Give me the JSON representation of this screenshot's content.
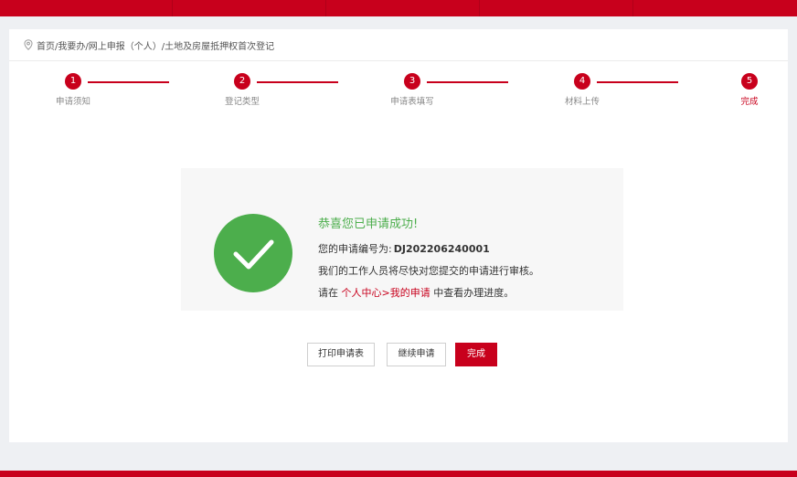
{
  "colors": {
    "accent": "#c8001c",
    "success": "#4cae4c"
  },
  "breadcrumb": {
    "icon": "location-pin-icon",
    "text": "首页/我要办/网上申报（个人）/土地及房屋抵押权首次登记"
  },
  "steps": [
    {
      "num": "1",
      "label": "申请须知"
    },
    {
      "num": "2",
      "label": "登记类型"
    },
    {
      "num": "3",
      "label": "申请表填写"
    },
    {
      "num": "4",
      "label": "材料上传"
    },
    {
      "num": "5",
      "label": "完成"
    }
  ],
  "result": {
    "icon": "check-circle-icon",
    "title": "恭喜您已申请成功!",
    "app_no_label": "您的申请编号为:",
    "app_no": "DJ202206240001",
    "review_text": "我们的工作人员将尽快对您提交的申请进行审核。",
    "progress_prefix": "请在",
    "progress_link": "个人中心>我的申请",
    "progress_suffix": "中查看办理进度。"
  },
  "actions": {
    "print_label": "打印申请表",
    "continue_label": "继续申请",
    "finish_label": "完成"
  }
}
